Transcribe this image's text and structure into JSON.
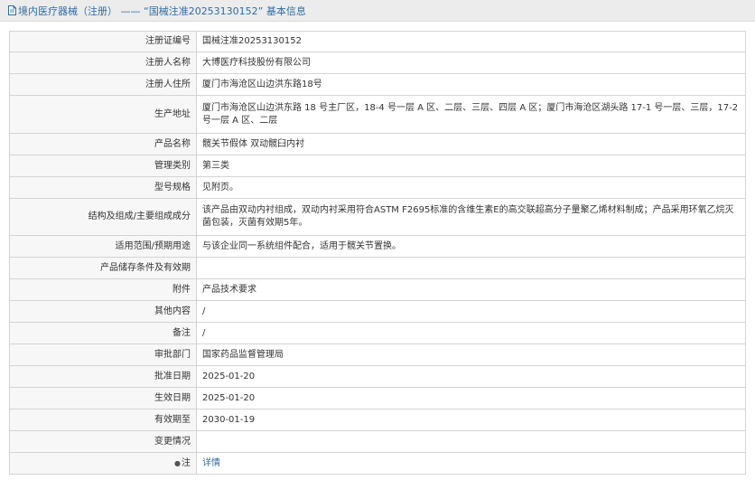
{
  "header": {
    "title": "境内医疗器械（注册） —— “国械注准20253130152” 基本信息",
    "icon": "document-icon"
  },
  "rows": [
    {
      "label": "注册证编号",
      "value": "国械注准20253130152"
    },
    {
      "label": "注册人名称",
      "value": "大博医疗科技股份有限公司"
    },
    {
      "label": "注册人住所",
      "value": "厦门市海沧区山边洪东路18号"
    },
    {
      "label": "生产地址",
      "value": "厦门市海沧区山边洪东路 18 号主厂区，18-4 号一层 A 区、二层、三层、四层 A 区；厦门市海沧区湖头路 17-1 号一层、三层，17-2 号一层 A 区、二层"
    },
    {
      "label": "产品名称",
      "value": "髋关节假体 双动髋臼内衬"
    },
    {
      "label": "管理类别",
      "value": "第三类"
    },
    {
      "label": "型号规格",
      "value": "见附页。"
    },
    {
      "label": "结构及组成/主要组成成分",
      "value": "该产品由双动内衬组成，双动内衬采用符合ASTM F2695标准的含维生素E的高交联超高分子量聚乙烯材料制成；产品采用环氧乙烷灭菌包装，灭菌有效期5年。"
    },
    {
      "label": "适用范围/预期用途",
      "value": "与该企业同一系统组件配合，适用于髋关节置换。"
    },
    {
      "label": "产品储存条件及有效期",
      "value": ""
    },
    {
      "label": "附件",
      "value": "产品技术要求"
    },
    {
      "label": "其他内容",
      "value": "/"
    },
    {
      "label": "备注",
      "value": "/"
    },
    {
      "label": "审批部门",
      "value": "国家药品监督管理局"
    },
    {
      "label": "批准日期",
      "value": "2025-01-20"
    },
    {
      "label": "生效日期",
      "value": "2025-01-20"
    },
    {
      "label": "有效期至",
      "value": "2030-01-19"
    },
    {
      "label": "变更情况",
      "value": ""
    }
  ],
  "note_row": {
    "bullet": "●",
    "label": "注",
    "link": "详情"
  }
}
